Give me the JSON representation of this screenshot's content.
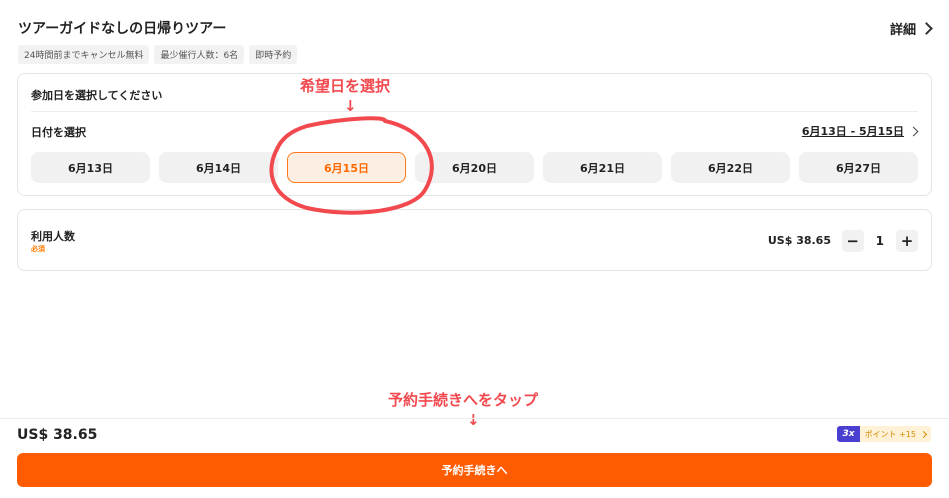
{
  "header": {
    "title": "ツアーガイドなしの日帰りツアー",
    "details_label": "詳細"
  },
  "tags": [
    "24時間前までキャンセル無料",
    "最少催行人数：6名",
    "即時予約"
  ],
  "date_section": {
    "header": "参加日を選択してください",
    "select_label": "日付を選択",
    "range_label": "6月13日 - 5月15日",
    "dates": [
      "6月13日",
      "6月14日",
      "6月15日",
      "6月20日",
      "6月21日",
      "6月22日",
      "6月27日"
    ],
    "selected": "6月15日"
  },
  "people_section": {
    "label": "利用人数",
    "required": "必須",
    "price": "US$ 38.65",
    "minus": "−",
    "count": "1",
    "plus": "+"
  },
  "annotations": {
    "top": "希望日を選択",
    "bottom": "予約手続きへをタップ",
    "arrow": "↓"
  },
  "footer": {
    "total": "US$ 38.65",
    "multiplier": "3x",
    "points": "ポイント +15",
    "book_button": "予約手続きへ"
  },
  "colors": {
    "accent": "#ff5b00",
    "annotation": "#f2494f",
    "selected_bg": "#fdeee3",
    "points_badge": "#4a3fd1"
  }
}
